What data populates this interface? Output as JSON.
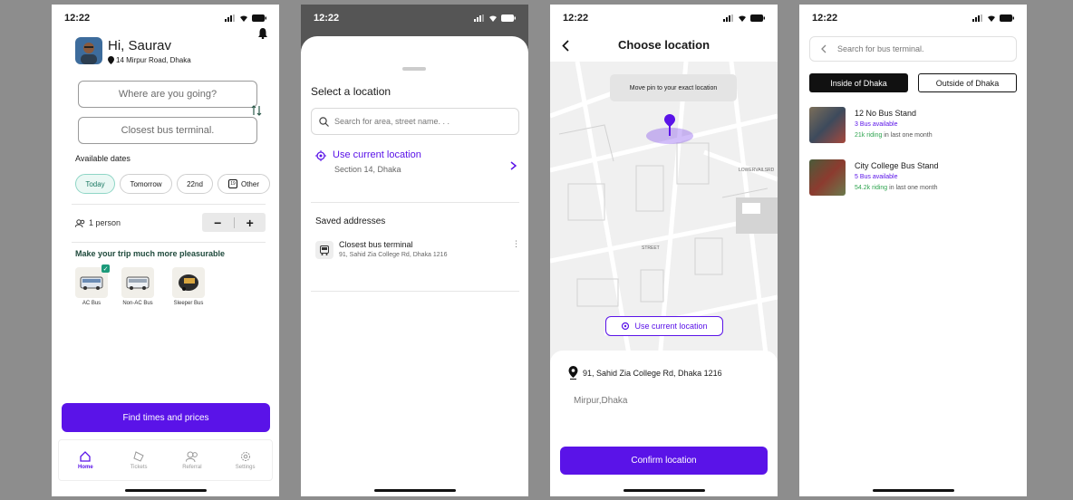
{
  "status_time": "12:22",
  "screen1": {
    "greeting": "Hi, Saurav",
    "address": "14 Mirpur Road, Dhaka",
    "where_placeholder": "Where are you going?",
    "terminal_placeholder": "Closest bus terminal.",
    "available_dates_label": "Available dates",
    "dates": [
      "Today",
      "Tomorrow",
      "22nd",
      "Other"
    ],
    "other_icon_day": "19",
    "person_label": "1 person",
    "minus": "−",
    "plus": "+",
    "promo_title": "Make your trip much more pleasurable",
    "bus_types": [
      "AC Bus",
      "Non-AC Bus",
      "Sleeper Bus"
    ],
    "find_button": "Find times and prices",
    "nav": [
      "Home",
      "Tickets",
      "Referral",
      "Settings"
    ]
  },
  "screen2": {
    "title": "Select a location",
    "search_placeholder": "Search for area, street name. . .",
    "use_current": "Use current location",
    "current_sub": "Section 14, Dhaka",
    "saved_title": "Saved addresses",
    "saved_item_title": "Closest bus terminal",
    "saved_item_sub": "91, Sahid Zia College Rd, Dhaka 1216"
  },
  "screen3": {
    "title": "Choose location",
    "tooltip": "Move pin to your exact location",
    "map_labels": [
      "LOWERVAILSRD",
      "STREET"
    ],
    "use_current": "Use current location",
    "address": "91, Sahid Zia College Rd, Dhaka 1216",
    "area": "Mirpur,Dhaka",
    "confirm": "Confirm location"
  },
  "screen4": {
    "search_placeholder": "Search for bus terminal.",
    "tab_inside": "Inside of Dhaka",
    "tab_outside": "Outside of Dhaka",
    "stands": [
      {
        "name": "12 No Bus Stand",
        "available": "3 Bus available",
        "riding": "21k riding",
        "suffix": " in last one month"
      },
      {
        "name": "City College Bus Stand",
        "available": "5 Bus available",
        "riding": "54.2k riding",
        "suffix": " in last one month"
      }
    ]
  },
  "colors": {
    "accent": "#5a13e8",
    "green": "#2ea44f",
    "dark_tab": "#111111"
  }
}
